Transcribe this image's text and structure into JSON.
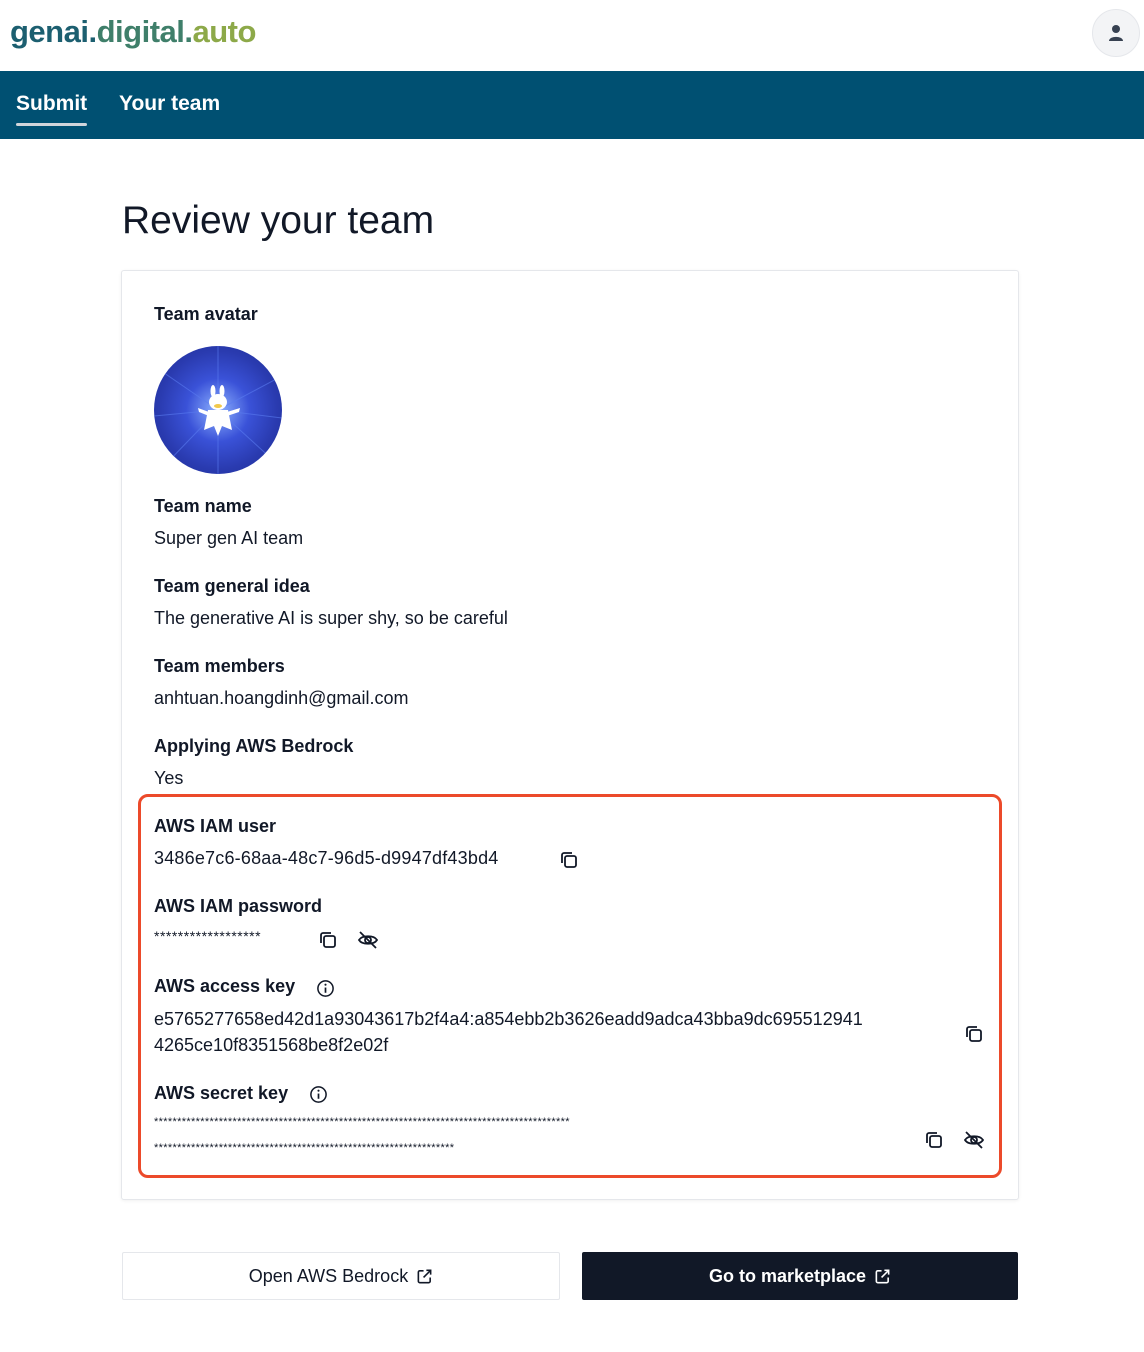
{
  "header": {
    "logo_part1": "genai.",
    "logo_part2": "digital.",
    "logo_part3": "auto",
    "account_icon": "user-icon"
  },
  "nav": {
    "tabs": [
      {
        "label": "Submit",
        "active": true
      },
      {
        "label": "Your team",
        "active": false
      }
    ]
  },
  "page": {
    "title": "Review your team"
  },
  "team": {
    "avatar_label": "Team avatar",
    "name_label": "Team name",
    "name": "Super gen AI team",
    "idea_label": "Team general idea",
    "idea": "The generative AI is super shy, so be careful",
    "members_label": "Team members",
    "members": "anhtuan.hoangdinh@gmail.com",
    "bedrock_label": "Applying AWS Bedrock",
    "bedrock": "Yes"
  },
  "aws": {
    "iam_user_label": "AWS IAM user",
    "iam_user": "3486e7c6-68aa-48c7-96d5-d9947df43bd4",
    "iam_password_label": "AWS IAM password",
    "iam_password": "******************",
    "access_key_label": "AWS access key",
    "access_key_line1": "e5765277658ed42d1a93043617b2f4a4:a854ebb2b3626eadd9adca43bba9dc695512941",
    "access_key_line2": "4265ce10f8351568be8f2e02f",
    "secret_key_label": "AWS secret key",
    "secret_key_line1": "******************************************************************************************",
    "secret_key_line2": "*****************************************************************",
    "highlight_color": "#ec4a2a"
  },
  "actions": {
    "open_bedrock": "Open AWS Bedrock",
    "marketplace": "Go to marketplace"
  },
  "colors": {
    "nav_bg": "#005072",
    "dark_button": "#111827"
  }
}
